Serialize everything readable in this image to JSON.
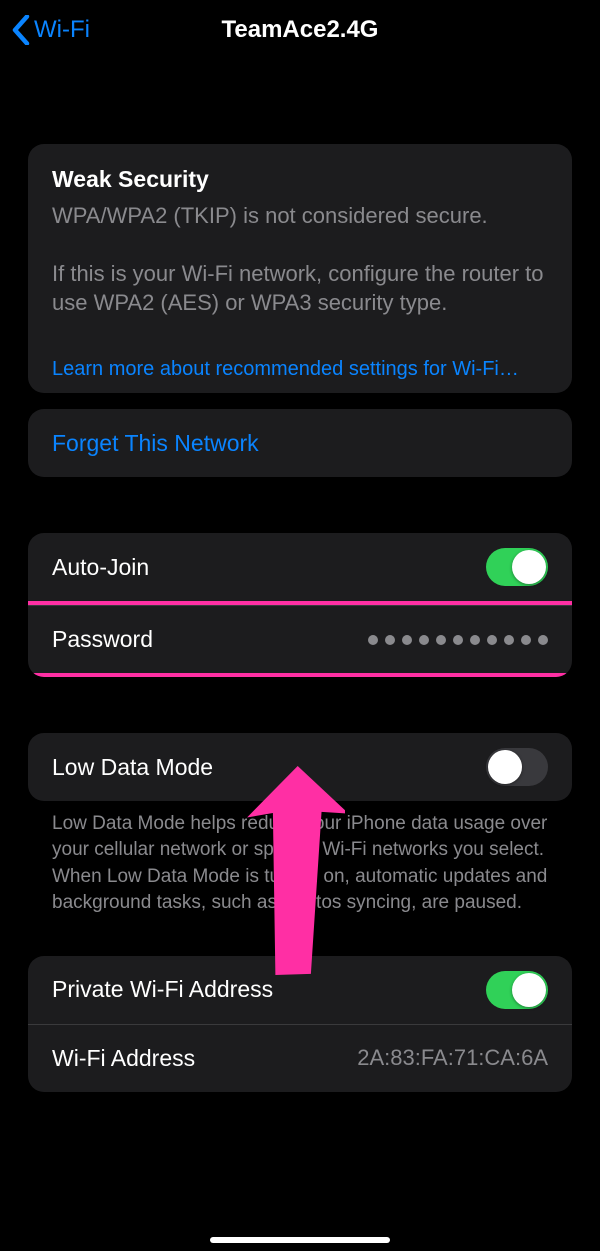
{
  "nav": {
    "back_label": "Wi-Fi",
    "title": "TeamAce2.4G"
  },
  "warning": {
    "heading": "Weak Security",
    "line1": "WPA/WPA2 (TKIP) is not considered secure.",
    "line2": "If this is your Wi-Fi network, configure the router to use WPA2 (AES) or WPA3 security type."
  },
  "learn_more": "Learn more about recommended settings for Wi-Fi…",
  "forget": "Forget This Network",
  "autojoin": {
    "label": "Auto-Join",
    "on": true
  },
  "password": {
    "label": "Password",
    "mask_count": 11
  },
  "lowdata": {
    "label": "Low Data Mode",
    "on": false,
    "note": "Low Data Mode helps reduce your iPhone data usage over your cellular network or specific Wi-Fi networks you select. When Low Data Mode is turned on, automatic updates and background tasks, such as Photos syncing, are paused."
  },
  "private_addr": {
    "label": "Private Wi-Fi Address",
    "on": true
  },
  "wifi_addr": {
    "label": "Wi-Fi Address",
    "value": "2A:83:FA:71:CA:6A"
  },
  "colors": {
    "accent": "#0a84ff",
    "toggle_on": "#30d158",
    "highlight": "#ff2fa4",
    "card_bg": "#1c1c1e",
    "muted": "#8a8a8e"
  }
}
